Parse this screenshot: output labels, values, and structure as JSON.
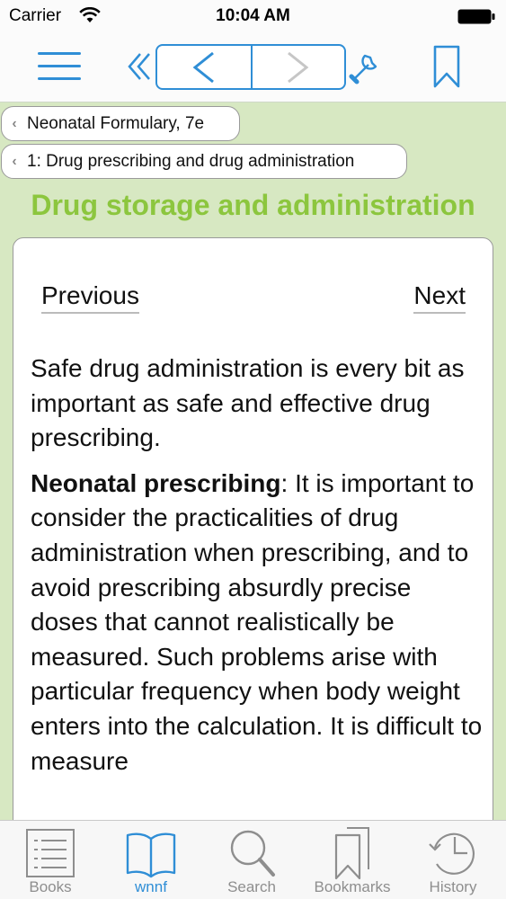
{
  "status_bar": {
    "carrier": "Carrier",
    "time": "10:04 AM"
  },
  "toolbar": {
    "accent_color": "#2f8ed6",
    "icons": [
      "menu-icon",
      "double-chevron-left-icon",
      "chevron-left-icon",
      "chevron-right-icon",
      "wrench-icon",
      "bookmark-icon"
    ]
  },
  "breadcrumbs": [
    {
      "label": "Neonatal Formulary, 7e"
    },
    {
      "label": "1: Drug prescribing and drug administration"
    }
  ],
  "page": {
    "title": "Drug storage and administration",
    "title_color": "#8cc63e",
    "previous_label": "Previous",
    "next_label": "Next",
    "para1": "Safe drug administration is every bit as important as safe and effective drug prescribing.",
    "para2_bold": "Neonatal prescribing",
    "para2_rest": ": It is important to consider the practicalities of drug administration when prescribing, and to avoid prescribing absurdly precise doses that cannot realistically be measured. Such problems arise with particular frequency when body weight enters into the calculation. It is difficult to measure"
  },
  "tabs": [
    {
      "label": "Books",
      "icon": "list-icon",
      "active": false
    },
    {
      "label": "wnnf",
      "icon": "open-book-icon",
      "active": true
    },
    {
      "label": "Search",
      "icon": "magnifier-icon",
      "active": false
    },
    {
      "label": "Bookmarks",
      "icon": "bookmarks-icon",
      "active": false
    },
    {
      "label": "History",
      "icon": "clock-icon",
      "active": false
    }
  ]
}
